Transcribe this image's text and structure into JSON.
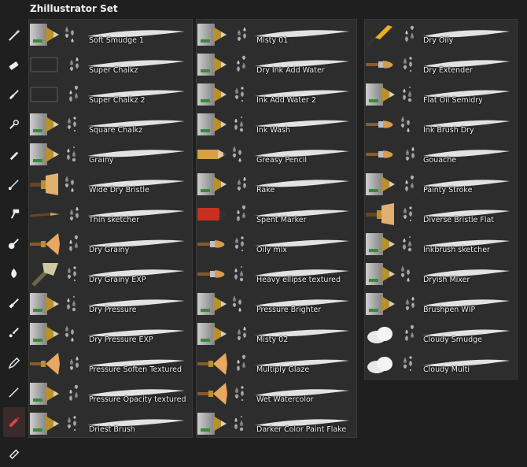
{
  "title": "Zhillustrator Set",
  "toolbar": [
    {
      "name": "brush-icon"
    },
    {
      "name": "eraser-icon"
    },
    {
      "name": "paint-brush-icon"
    },
    {
      "name": "fill-brush-icon"
    },
    {
      "name": "pen-icon"
    },
    {
      "name": "fine-brush-icon"
    },
    {
      "name": "roller-icon"
    },
    {
      "name": "round-brush-icon"
    },
    {
      "name": "drop-icon"
    },
    {
      "name": "flat-brush-icon"
    },
    {
      "name": "sparkle-brush-icon"
    },
    {
      "name": "pencil-icon"
    },
    {
      "name": "thin-brush-icon"
    },
    {
      "name": "marker-icon",
      "active": true
    },
    {
      "name": "eraser-pencil-icon"
    }
  ],
  "columns": [
    [
      {
        "label": "Soft Smudge 1",
        "icon": "blender"
      },
      {
        "label": "Super Chalkz",
        "icon": "chalk"
      },
      {
        "label": "Super Chalkz 2",
        "icon": "chalk"
      },
      {
        "label": "Square Chalkz",
        "icon": "blender"
      },
      {
        "label": "Grainy",
        "icon": "blender"
      },
      {
        "label": "Wide Dry Bristle",
        "icon": "bristle"
      },
      {
        "label": "Thin sketcher",
        "icon": "fine"
      },
      {
        "label": "Dry Grainy",
        "icon": "fan"
      },
      {
        "label": "Dry Grainy EXP",
        "icon": "wide"
      },
      {
        "label": "Dry Pressure",
        "icon": "blender"
      },
      {
        "label": "Dry Pressure EXP",
        "icon": "blender"
      },
      {
        "label": "Pressure Soften Textured",
        "icon": "fan"
      },
      {
        "label": "Pressure Opacity textured",
        "icon": "blender"
      },
      {
        "label": "Driest Brush",
        "icon": "blender"
      }
    ],
    [
      {
        "label": "Misty 01",
        "icon": "blender"
      },
      {
        "label": "Dry Ink Add Water",
        "icon": "blender"
      },
      {
        "label": "Ink Add Water 2",
        "icon": "blender"
      },
      {
        "label": "Ink Wash",
        "icon": "blender"
      },
      {
        "label": "Greasy Pencil",
        "icon": "pencil"
      },
      {
        "label": "Rake",
        "icon": "blender"
      },
      {
        "label": "Spent Marker",
        "icon": "marker"
      },
      {
        "label": "Oily mix",
        "icon": "round"
      },
      {
        "label": "Heavy ellipse textured",
        "icon": "round"
      },
      {
        "label": "Pressure Brighter",
        "icon": "blender"
      },
      {
        "label": "Misty 02",
        "icon": "blender"
      },
      {
        "label": "Multiply Glaze",
        "icon": "fan"
      },
      {
        "label": "Wet Watercolor",
        "icon": "fan"
      },
      {
        "label": "Darker Color Paint Flake",
        "icon": "blender"
      }
    ],
    [
      {
        "label": "Dry Oily",
        "icon": "nib"
      },
      {
        "label": "Dry Extender",
        "icon": "round"
      },
      {
        "label": "Flat Oil Semidry",
        "icon": "blender"
      },
      {
        "label": "Ink Brush Dry",
        "icon": "round"
      },
      {
        "label": "Gouache",
        "icon": "round"
      },
      {
        "label": "Painty Stroke",
        "icon": "blender"
      },
      {
        "label": "Diverse Bristle Flat",
        "icon": "bristle"
      },
      {
        "label": "Inkbrush sketcher",
        "icon": "blender"
      },
      {
        "label": "Dryish Mixer",
        "icon": "blender"
      },
      {
        "label": "Brushpen WIP",
        "icon": "blender"
      },
      {
        "label": "Cloudy Smudge",
        "icon": "cloud"
      },
      {
        "label": "Cloudy Multi",
        "icon": "cloud"
      }
    ]
  ]
}
